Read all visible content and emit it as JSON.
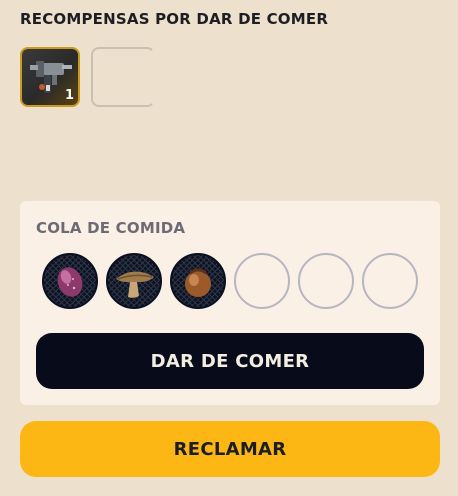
{
  "rewards": {
    "title": "RECOMPENSAS POR DAR DE COMER",
    "items": [
      {
        "icon": "mining-drill-icon",
        "quantity": "1"
      },
      {
        "icon": "empty-slot"
      }
    ],
    "accent_color": "#c89a1e"
  },
  "food_queue": {
    "title": "COLA DE COMIDA",
    "slots": [
      {
        "icon": "purple-berry-icon",
        "filled": true
      },
      {
        "icon": "mushroom-icon",
        "filled": true
      },
      {
        "icon": "hazelnut-icon",
        "filled": true
      },
      {
        "icon": "empty-slot",
        "filled": false
      },
      {
        "icon": "empty-slot",
        "filled": false
      },
      {
        "icon": "empty-slot",
        "filled": false
      }
    ],
    "feed_button_label": "DAR DE COMER"
  },
  "claim_button_label": "RECLAMAR",
  "colors": {
    "background": "#ede0cc",
    "panel": "#faf0e6",
    "primary_button": "#070b1a",
    "claim_button": "#fdb714"
  }
}
